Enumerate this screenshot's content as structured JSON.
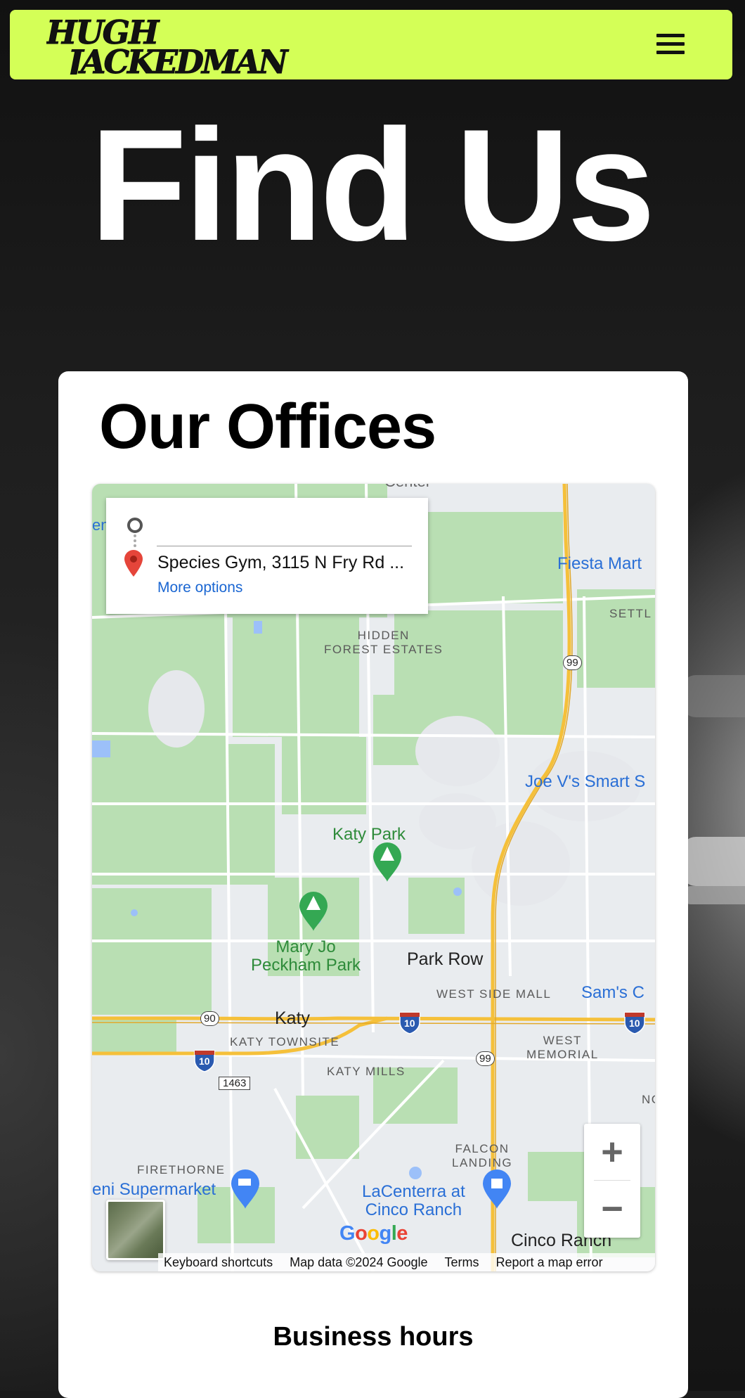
{
  "header": {
    "logo_line1": "HUGH",
    "logo_line2": "JACKEDMAN",
    "menu_icon": "hamburger-icon"
  },
  "hero": {
    "title": "Find Us"
  },
  "offices": {
    "heading": "Our Offices",
    "map": {
      "directions": {
        "destination": "Species Gym, 3115 N Fry Rd ...",
        "more_options": "More options"
      },
      "labels": {
        "hidden_forest": "HIDDEN\nFOREST ESTATES",
        "fiesta": "Fiesta Mart",
        "settl": "SETTL",
        "joe_v": "Joe V's Smart S",
        "katy_park": "Katy Park",
        "mary_jo": "Mary Jo\nPeckham Park",
        "park_row": "Park Row",
        "west_side_mall": "WEST SIDE MALL",
        "sams": "Sam's C",
        "katy": "Katy",
        "katy_townsite": "KATY TOWNSITE",
        "west_memorial": "WEST\nMEMORIAL",
        "katy_mills": "KATY MILLS",
        "falcon_landing": "FALCON\nLANDING",
        "firethorne": "FIRETHORNE",
        "supermarket": "eni Supermarket",
        "lacenterra": "LaCenterra at\nCinco Ranch",
        "cinco_ranch": "Cinco Ranch",
        "nc": "NC",
        "en": "en",
        "center": "Center"
      },
      "shields": {
        "hwy99_a": "99",
        "hwy99_b": "99",
        "us90": "90",
        "i10_a": "10",
        "i10_b": "10",
        "i10_c": "10",
        "fm1463": "1463"
      },
      "zoom_in": "+",
      "zoom_out": "−",
      "google": "Google",
      "attribution": {
        "shortcuts": "Keyboard shortcuts",
        "map_data": "Map data ©2024 Google",
        "terms": "Terms",
        "report": "Report a map error"
      }
    },
    "hours_title": "Business hours"
  },
  "colors": {
    "accent": "#d4ff57",
    "map_green": "#b7dfb0",
    "highway": "#f5c03a",
    "link_blue": "#1a66d2"
  }
}
